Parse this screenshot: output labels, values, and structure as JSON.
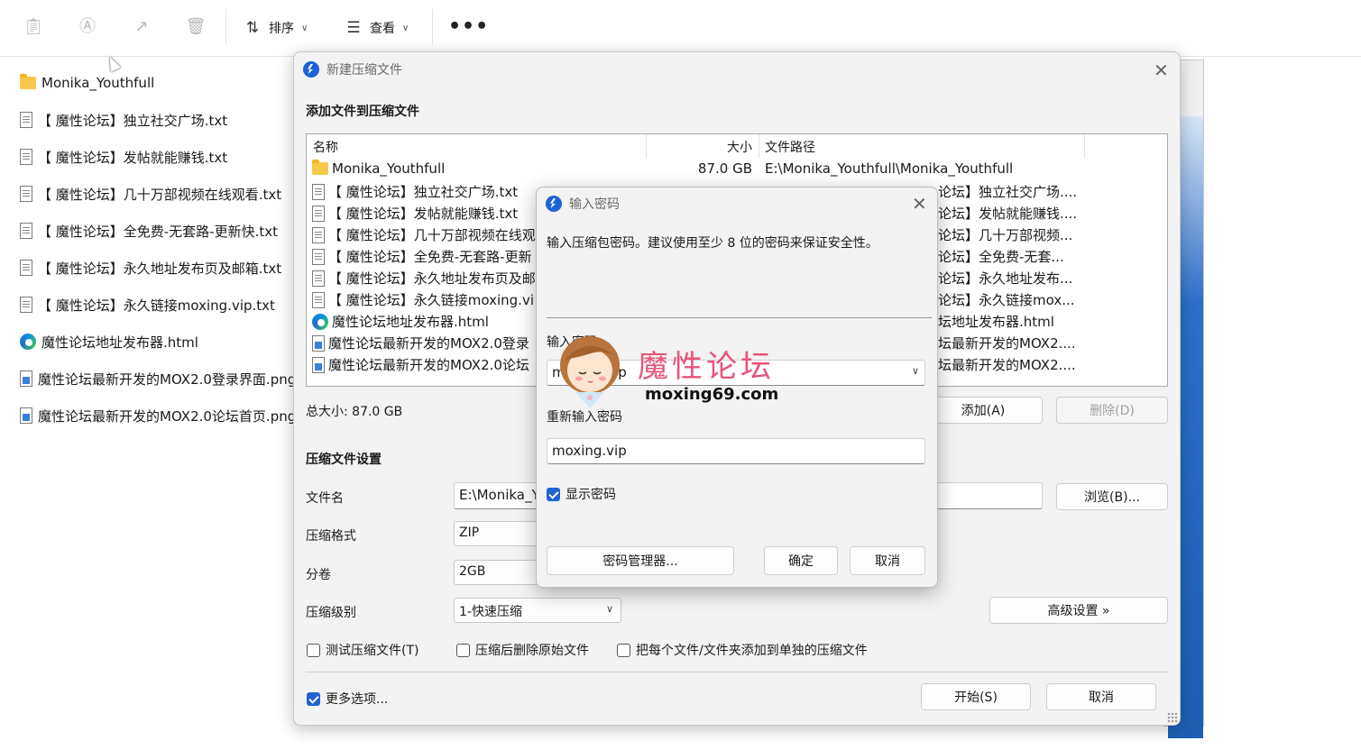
{
  "toolbar": {
    "sort_label": "排序",
    "view_label": "查看",
    "more_label": "•••"
  },
  "explorer": {
    "files": [
      {
        "name": "Monika_Youthfull",
        "type": "folder"
      },
      {
        "name": "【 魔性论坛】独立社交广场.txt",
        "type": "txt"
      },
      {
        "name": "【 魔性论坛】发帖就能赚钱.txt",
        "type": "txt"
      },
      {
        "name": "【 魔性论坛】几十万部视频在线观看.txt",
        "type": "txt"
      },
      {
        "name": "【 魔性论坛】全免费-无套路-更新快.txt",
        "type": "txt"
      },
      {
        "name": "【 魔性论坛】永久地址发布页及邮箱.txt",
        "type": "txt"
      },
      {
        "name": "【 魔性论坛】永久链接moxing.vip.txt",
        "type": "txt"
      },
      {
        "name": "魔性论坛地址发布器.html",
        "type": "html"
      },
      {
        "name": "魔性论坛最新开发的MOX2.0登录界面.png",
        "type": "png"
      },
      {
        "name": "魔性论坛最新开发的MOX2.0论坛首页.png",
        "type": "png"
      }
    ]
  },
  "main_dialog": {
    "title": "新建压缩文件",
    "add_files_heading": "添加文件到压缩文件",
    "columns": {
      "name": "名称",
      "size": "大小",
      "path": "文件路径"
    },
    "rows": [
      {
        "name": "Monika_Youthfull",
        "type": "folder",
        "size": "87.0 GB",
        "path": "E:\\Monika_Youthfull\\Monika_Youthfull"
      },
      {
        "name": "【 魔性论坛】独立社交广场.txt",
        "type": "txt",
        "size": "",
        "path": "论坛】独立社交广场...."
      },
      {
        "name": "【 魔性论坛】发帖就能赚钱.txt",
        "type": "txt",
        "size": "",
        "path": "论坛】发帖就能赚钱...."
      },
      {
        "name": "【 魔性论坛】几十万部视频在线观",
        "type": "txt",
        "size": "",
        "path": "论坛】几十万部视频..."
      },
      {
        "name": "【 魔性论坛】全免费-无套路-更新",
        "type": "txt",
        "size": "",
        "path": "论坛】全免费-无套..."
      },
      {
        "name": "【 魔性论坛】永久地址发布页及邮",
        "type": "txt",
        "size": "",
        "path": "论坛】永久地址发布..."
      },
      {
        "name": "【 魔性论坛】永久链接moxing.vi",
        "type": "txt",
        "size": "",
        "path": "论坛】永久链接mox..."
      },
      {
        "name": "魔性论坛地址发布器.html",
        "type": "html",
        "size": "",
        "path": "坛地址发布器.html"
      },
      {
        "name": "魔性论坛最新开发的MOX2.0登录",
        "type": "png",
        "size": "",
        "path": "坛最新开发的MOX2...."
      },
      {
        "name": "魔性论坛最新开发的MOX2.0论坛",
        "type": "png",
        "size": "",
        "path": "坛最新开发的MOX2...."
      }
    ],
    "total_size": "总大小: 87.0 GB",
    "add_button": "添加(A)",
    "delete_button": "删除(D)",
    "settings_heading": "压缩文件设置",
    "filename_label": "文件名",
    "filename_value": "E:\\Monika_Y",
    "browse_button": "浏览(B)...",
    "format_label": "压缩格式",
    "format_value": "ZIP",
    "split_label": "分卷",
    "split_value": "2GB",
    "level_label": "压缩级别",
    "level_value": "1-快速压缩",
    "advanced_button": "高级设置 »",
    "test_checkbox": "测试压缩文件(T)",
    "delete_after_checkbox": "压缩后删除原始文件",
    "separate_checkbox": "把每个文件/文件夹添加到单独的压缩文件",
    "more_options_checkbox": "更多选项...",
    "start_button": "开始(S)",
    "cancel_button": "取消"
  },
  "password_dialog": {
    "title": "输入密码",
    "description": "输入压缩包密码。建议使用至少 8 位的密码来保证安全性。",
    "enter_label": "输入密码",
    "enter_value": "moxing.vip",
    "reenter_label": "重新输入密码",
    "reenter_value": "moxing.vip",
    "show_password_checkbox": "显示密码",
    "manager_button": "密码管理器...",
    "ok_button": "确定",
    "cancel_button": "取消"
  },
  "watermark": {
    "title": "魔性论坛",
    "url": "moxing69.com"
  },
  "colors": {
    "accent": "#1f63d3",
    "folder": "#f7c948",
    "watermark": "#e8547a"
  }
}
